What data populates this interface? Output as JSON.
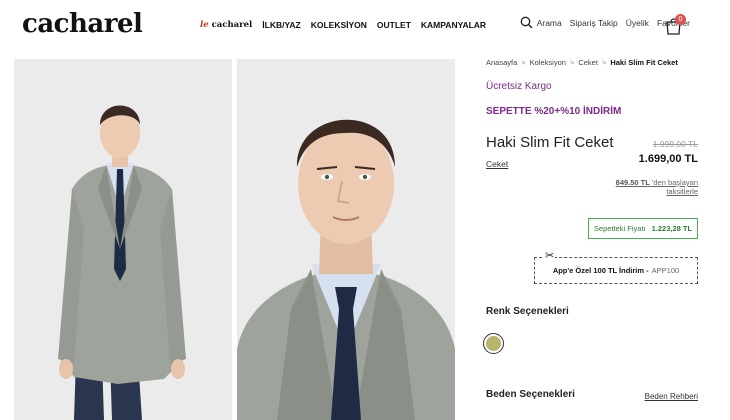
{
  "header": {
    "logo": "cacharel",
    "nav": [
      {
        "label": "le cacharel",
        "special": true
      },
      {
        "label": "İLKB/YAZ"
      },
      {
        "label": "KOLEKSİYON"
      },
      {
        "label": "OUTLET"
      },
      {
        "label": "KAMPANYALAR"
      }
    ],
    "util": {
      "search": "Arama",
      "order": "Sipariş Takip",
      "member": "Üyelik",
      "favorites": "Favoriler",
      "cart_count": "0"
    }
  },
  "breadcrumb": {
    "items": [
      "Anasayfa",
      "Koleksiyon",
      "Ceket"
    ],
    "current": "Haki Slim Fit Ceket",
    "sep": ">"
  },
  "product": {
    "shipping": "Ücretsiz Kargo",
    "promo": "SEPETTE %20+%10 İNDİRİM",
    "title": "Haki Slim Fit Ceket",
    "category": "Ceket",
    "old_price": "1.999,00 TL",
    "price": "1.699,00 TL",
    "installment_amount": "849.50 TL",
    "installment_text": "'den başlayan taksitlerle",
    "basket_label": "Sepetteki Fiyatı",
    "basket_price": "1.223,28 TL",
    "coupon_label": "App'e Özel 100 TL İndirim -",
    "coupon_code": "APP100",
    "color_heading": "Renk Seçenekleri",
    "color_swatch": "#b8b56a",
    "size_heading": "Beden Seçenekleri",
    "size_guide": "Beden Rehberi"
  },
  "colors": {
    "purple": "#7b2a8a",
    "green": "#4caf50",
    "badge": "#d9534f"
  }
}
